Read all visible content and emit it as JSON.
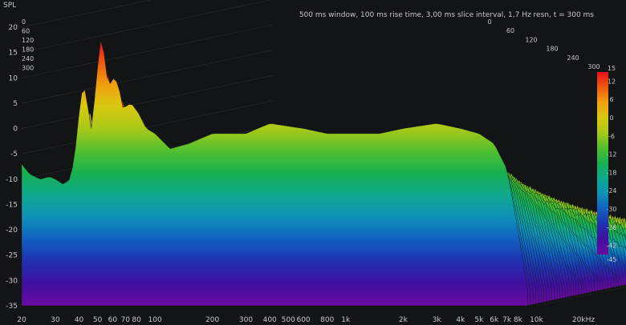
{
  "chart_data": {
    "type": "waterfall",
    "title": "500 ms window, 100 ms rise time, 3,00 ms slice interval, 1,7 Hz resn, t = 300 ms",
    "ylabel": "SPL",
    "xunit_label": "20kHz",
    "x_axis": {
      "scale": "log",
      "range": [
        20,
        20000
      ],
      "ticks": [
        {
          "value": 20,
          "label": "20"
        },
        {
          "value": 30,
          "label": "30"
        },
        {
          "value": 40,
          "label": "40"
        },
        {
          "value": 50,
          "label": "50"
        },
        {
          "value": 60,
          "label": "60"
        },
        {
          "value": 70,
          "label": "70"
        },
        {
          "value": 80,
          "label": "80"
        },
        {
          "value": 100,
          "label": "100"
        },
        {
          "value": 200,
          "label": "200"
        },
        {
          "value": 300,
          "label": "300"
        },
        {
          "value": 400,
          "label": "400"
        },
        {
          "value": 500,
          "label": "500"
        },
        {
          "value": 600,
          "label": "600"
        },
        {
          "value": 800,
          "label": "800"
        },
        {
          "value": 1000,
          "label": "1k"
        },
        {
          "value": 2000,
          "label": "2k"
        },
        {
          "value": 3000,
          "label": "3k"
        },
        {
          "value": 4000,
          "label": "4k"
        },
        {
          "value": 5000,
          "label": "5k"
        },
        {
          "value": 6000,
          "label": "6k"
        },
        {
          "value": 7000,
          "label": "7k"
        },
        {
          "value": 8000,
          "label": "8k"
        },
        {
          "value": 10000,
          "label": "10k"
        }
      ]
    },
    "y_axis": {
      "range": [
        -35,
        20
      ],
      "ticks": [
        {
          "value": 20,
          "label": "20"
        },
        {
          "value": 15,
          "label": "15"
        },
        {
          "value": 10,
          "label": "10"
        },
        {
          "value": 5,
          "label": "5"
        },
        {
          "value": 0,
          "label": "0"
        },
        {
          "value": -5,
          "label": "-5"
        },
        {
          "value": -10,
          "label": "-10"
        },
        {
          "value": -15,
          "label": "-15"
        },
        {
          "value": -20,
          "label": "-20"
        },
        {
          "value": -25,
          "label": "-25"
        },
        {
          "value": -30,
          "label": "-30"
        },
        {
          "value": -35,
          "label": "-35"
        }
      ]
    },
    "time_axis_ms": {
      "ticks": [
        {
          "value": 0,
          "label": "0"
        },
        {
          "value": 60,
          "label": "60"
        },
        {
          "value": 120,
          "label": "120"
        },
        {
          "value": 180,
          "label": "180"
        },
        {
          "value": 240,
          "label": "240"
        },
        {
          "value": 300,
          "label": "300"
        }
      ],
      "left_labels": [
        "0",
        "60",
        "120",
        "180",
        "240",
        "300"
      ]
    },
    "colorbar": {
      "range": [
        -45,
        15
      ],
      "ticks": [
        {
          "value": 15,
          "label": "15"
        },
        {
          "value": 12,
          "label": "12"
        },
        {
          "value": 6,
          "label": "6"
        },
        {
          "value": 0,
          "label": "0"
        },
        {
          "value": -6,
          "label": "-6"
        },
        {
          "value": -12,
          "label": "-12"
        },
        {
          "value": -18,
          "label": "-18"
        },
        {
          "value": -24,
          "label": "-24"
        },
        {
          "value": -30,
          "label": "-30"
        },
        {
          "value": -36,
          "label": "-36"
        },
        {
          "value": -42,
          "label": "-42"
        },
        {
          "value": -45,
          "label": "-45"
        }
      ],
      "colors": [
        "#e8101a",
        "#f05a10",
        "#f0a010",
        "#d8c810",
        "#a8c818",
        "#50c030",
        "#18b050",
        "#10a890",
        "#1090b8",
        "#1060c0",
        "#2030b0",
        "#4010a0",
        "#6a0aa0"
      ]
    },
    "front_slice_spl": [
      {
        "f": 20,
        "spl": -7
      },
      {
        "f": 22,
        "spl": -9
      },
      {
        "f": 25,
        "spl": -10
      },
      {
        "f": 28,
        "spl": -9.5
      },
      {
        "f": 30,
        "spl": -10
      },
      {
        "f": 33,
        "spl": -11
      },
      {
        "f": 36,
        "spl": -10
      },
      {
        "f": 38,
        "spl": -5
      },
      {
        "f": 40,
        "spl": 3
      },
      {
        "f": 42,
        "spl": 9
      },
      {
        "f": 44,
        "spl": 6
      },
      {
        "f": 46,
        "spl": -1
      },
      {
        "f": 48,
        "spl": 5
      },
      {
        "f": 50,
        "spl": 12
      },
      {
        "f": 52,
        "spl": 17.5
      },
      {
        "f": 54,
        "spl": 15
      },
      {
        "f": 57,
        "spl": 8
      },
      {
        "f": 60,
        "spl": 10
      },
      {
        "f": 64,
        "spl": 9
      },
      {
        "f": 68,
        "spl": 4
      },
      {
        "f": 75,
        "spl": 5
      },
      {
        "f": 82,
        "spl": 3
      },
      {
        "f": 90,
        "spl": 0
      },
      {
        "f": 100,
        "spl": -1
      },
      {
        "f": 120,
        "spl": -4
      },
      {
        "f": 150,
        "spl": -3
      },
      {
        "f": 200,
        "spl": -1
      },
      {
        "f": 300,
        "spl": -1
      },
      {
        "f": 400,
        "spl": 1
      },
      {
        "f": 600,
        "spl": 0
      },
      {
        "f": 800,
        "spl": -1
      },
      {
        "f": 1000,
        "spl": -1
      },
      {
        "f": 1500,
        "spl": -1
      },
      {
        "f": 2000,
        "spl": 0
      },
      {
        "f": 3000,
        "spl": 1
      },
      {
        "f": 4000,
        "spl": 0
      },
      {
        "f": 5000,
        "spl": -1
      },
      {
        "f": 6000,
        "spl": -3
      },
      {
        "f": 7000,
        "spl": -8
      },
      {
        "f": 8000,
        "spl": -20
      },
      {
        "f": 9000,
        "spl": -32
      }
    ],
    "back_slice_spl": [
      {
        "f": 20,
        "spl": -35
      },
      {
        "f": 100,
        "spl": -35
      },
      {
        "f": 400,
        "spl": -34
      },
      {
        "f": 2000,
        "spl": -34
      },
      {
        "f": 8000,
        "spl": -34
      },
      {
        "f": 10000,
        "spl": -35
      }
    ],
    "grid": true
  }
}
